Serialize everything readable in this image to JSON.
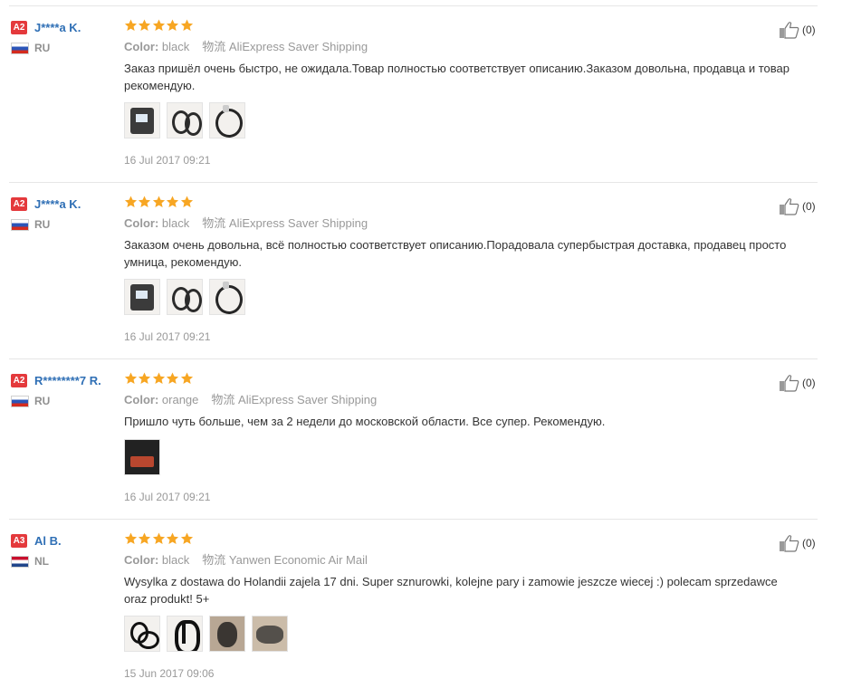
{
  "colors": {
    "link": "#2f6fb5",
    "star": "#f7a623",
    "level_badge": "#e4393c",
    "muted": "#999999"
  },
  "labels": {
    "color_label": "Color:",
    "logistics_label": "物流"
  },
  "reviews": [
    {
      "level": "A2",
      "name": "J****a K.",
      "country": "RU",
      "flag": "ru",
      "rating": 5,
      "color": "black",
      "shipping": "AliExpress Saver Shipping",
      "text": "Заказ пришёл очень быстро, не ожидала.Товар полностью соответствует описанию.Заказом довольна, продавца и товар рекомендую.",
      "photos": [
        "photo-device",
        "photo-cord",
        "photo-cord-loop"
      ],
      "date": "16 Jul 2017 09:21",
      "helpful": "(0)"
    },
    {
      "level": "A2",
      "name": "J****a K.",
      "country": "RU",
      "flag": "ru",
      "rating": 5,
      "color": "black",
      "shipping": "AliExpress Saver Shipping",
      "text": "Заказом очень довольна, всё полностью соответствует описанию.Порадовала супербыстрая доставка, продавец просто умница, рекомендую.",
      "photos": [
        "photo-device",
        "photo-cord",
        "photo-cord-loop"
      ],
      "date": "16 Jul 2017 09:21",
      "helpful": "(0)"
    },
    {
      "level": "A2",
      "name": "R********7 R.",
      "country": "RU",
      "flag": "ru",
      "rating": 5,
      "color": "orange",
      "shipping": "AliExpress Saver Shipping",
      "text": "Пришло чуть больше, чем за 2 недели до московской области. Все супер. Рекомендую.",
      "photos": [
        "photo-package"
      ],
      "date": "16 Jul 2017 09:21",
      "helpful": "(0)"
    },
    {
      "level": "A3",
      "name": "Al B.",
      "country": "NL",
      "flag": "nl",
      "rating": 5,
      "color": "black",
      "shipping": "Yanwen Economic Air Mail",
      "text": "Wysylka z dostawa do Holandii zajela 17 dni. Super sznurowki, kolejne pary i zamowie jeszcze wiecej :) polecam sprzedawce oraz produkt! 5+",
      "photos": [
        "photo-laces",
        "photo-laces-coil",
        "photo-shoe",
        "photo-shoe-side"
      ],
      "date": "15 Jun 2017 09:06",
      "helpful": "(0)"
    }
  ]
}
